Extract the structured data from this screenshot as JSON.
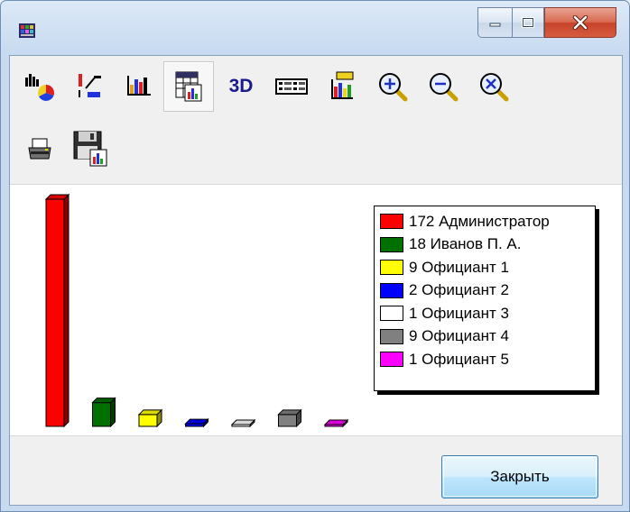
{
  "window": {
    "title": ""
  },
  "toolbar": {
    "buttons_row1": [
      {
        "name": "gallery-button",
        "icon": "chart-gallery-icon"
      },
      {
        "name": "edit-series-button",
        "icon": "series-edit-icon"
      },
      {
        "name": "bar-type-button",
        "icon": "bar-chart-icon"
      },
      {
        "name": "data-grid-button",
        "icon": "data-grid-icon"
      },
      {
        "name": "3d-toggle-button",
        "label": "3D"
      },
      {
        "name": "legend-toggle-button",
        "icon": "legend-icon"
      },
      {
        "name": "titles-button",
        "icon": "chart-title-icon"
      },
      {
        "name": "zoom-in-button",
        "icon": "zoom-in-icon"
      },
      {
        "name": "zoom-out-button",
        "icon": "zoom-out-icon"
      },
      {
        "name": "zoom-reset-button",
        "icon": "zoom-reset-icon"
      }
    ],
    "buttons_row2": [
      {
        "name": "print-button",
        "icon": "printer-icon"
      },
      {
        "name": "save-button",
        "icon": "floppy-disk-icon"
      }
    ],
    "label_3d": "3D"
  },
  "chart_data": {
    "type": "bar",
    "three_d": true,
    "categories": [
      "Администратор",
      "Иванов П. А.",
      "Официант 1",
      "Официант 2",
      "Официант 3",
      "Официант 4",
      "Официант 5"
    ],
    "values": [
      172,
      18,
      9,
      2,
      1,
      9,
      1
    ],
    "colors": [
      "#ff0000",
      "#007000",
      "#ffff00",
      "#0000ff",
      "#ffffff",
      "#808080",
      "#ff00ff"
    ],
    "legend": [
      "172 Администратор",
      "18 Иванов П. А.",
      "9 Официант 1",
      "2 Официант 2",
      "1 Официант 3",
      "9 Официант 4",
      "1 Официант 5"
    ],
    "legend_position": "right",
    "axes_visible": false,
    "grid": false
  },
  "footer": {
    "close_label": "Закрыть"
  }
}
